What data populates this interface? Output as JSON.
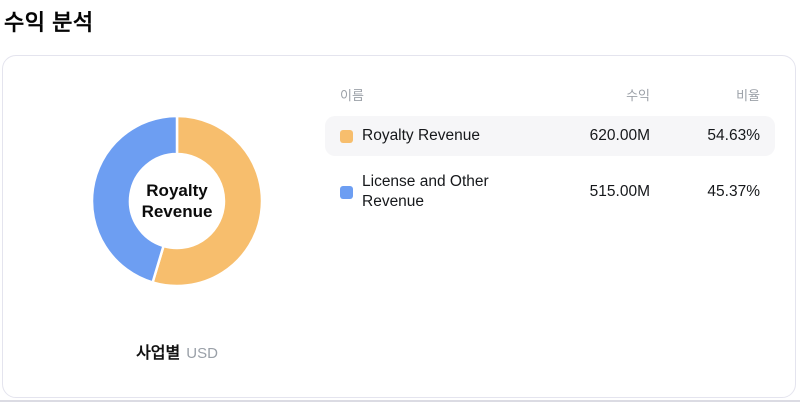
{
  "page": {
    "title": "수익 분석"
  },
  "card": {
    "chart": {
      "center_label": "Royalty Revenue",
      "caption": "사업별",
      "caption_unit": "USD"
    },
    "table": {
      "headers": {
        "name": "이름",
        "revenue": "수익",
        "ratio": "비율"
      },
      "rows": [
        {
          "name": "Royalty Revenue",
          "revenue": "620.00M",
          "ratio": "54.63%",
          "color": "#F7BE6D",
          "highlighted": true
        },
        {
          "name": "License and Other Revenue",
          "revenue": "515.00M",
          "ratio": "45.37%",
          "color": "#6D9EF2",
          "highlighted": false
        }
      ]
    }
  },
  "chart_data": {
    "type": "pie",
    "donut": true,
    "title": "수익 분석",
    "caption": "사업별 USD",
    "categories": [
      "Royalty Revenue",
      "License and Other Revenue"
    ],
    "values": [
      620.0,
      515.0
    ],
    "value_labels": [
      "620.00M",
      "515.00M"
    ],
    "unit": "USD (M)",
    "percentages": [
      54.63,
      45.37
    ],
    "colors": [
      "#F7BE6D",
      "#6D9EF2"
    ],
    "start_angle_deg": -90,
    "direction": "clockwise",
    "inner_radius_ratio": 0.55,
    "center_label": "Royalty Revenue",
    "legend_position": "right-table"
  }
}
